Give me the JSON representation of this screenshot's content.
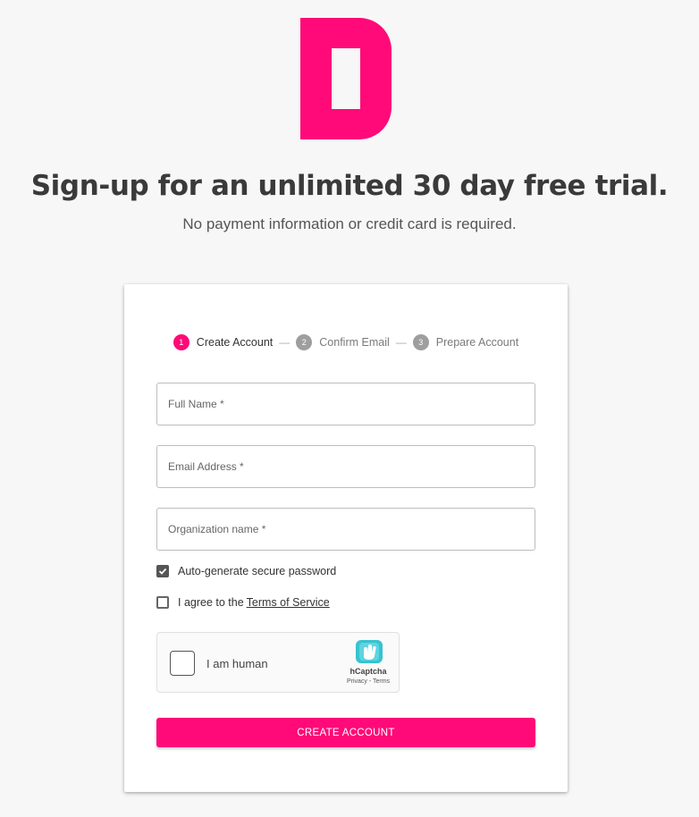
{
  "brand": {
    "logo_icon": "d-letter-logo",
    "accent_color": "#ff0a78"
  },
  "hero": {
    "title": "Sign-up for an unlimited 30 day free trial.",
    "subtitle": "No payment information or credit card is required."
  },
  "stepper": {
    "separator": "—",
    "steps": [
      {
        "number": "1",
        "label": "Create Account",
        "active": true
      },
      {
        "number": "2",
        "label": "Confirm Email",
        "active": false
      },
      {
        "number": "3",
        "label": "Prepare Account",
        "active": false
      }
    ]
  },
  "form": {
    "full_name": {
      "placeholder": "Full Name *",
      "value": ""
    },
    "email": {
      "placeholder": "Email Address *",
      "value": ""
    },
    "organization": {
      "placeholder": "Organization name *",
      "value": ""
    },
    "auto_password": {
      "label": "Auto-generate secure password",
      "checked": true
    },
    "terms": {
      "label": "I agree to the",
      "link": "Terms of Service",
      "checked": false
    },
    "submit_label": "CREATE ACCOUNT"
  },
  "captcha": {
    "label": "I am human",
    "brand": "hCaptcha",
    "links": "Privacy - Terms",
    "icon": "hcaptcha-logo-icon"
  }
}
